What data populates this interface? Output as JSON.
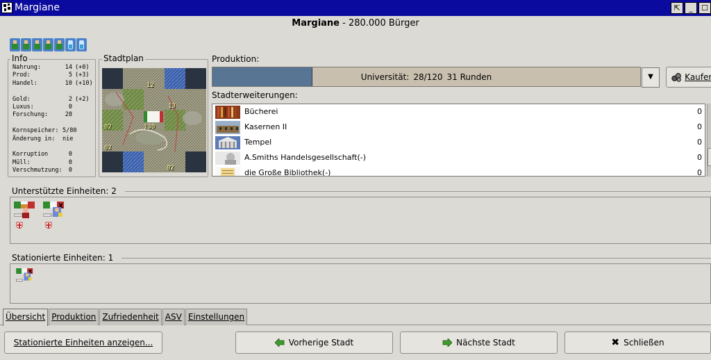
{
  "window": {
    "title": "Margiane",
    "controls": {
      "pin": "⇱",
      "minimize": "_",
      "maximize": "☐"
    }
  },
  "header": {
    "city_name": "Margiane",
    "population": "- 280.000 Bürger"
  },
  "citizens": {
    "icons": [
      "worker-citizen-icon",
      "worker-citizen-icon",
      "worker-citizen-icon",
      "worker-citizen-icon",
      "worker-citizen-icon",
      "scientist-citizen-icon",
      "scientist-citizen-icon"
    ]
  },
  "info": {
    "label": "Info",
    "rows": [
      {
        "key": "Nahrung:",
        "value": "14",
        "delta": "(+0)"
      },
      {
        "key": "Prod:",
        "value": "5",
        "delta": "(+3)"
      },
      {
        "key": "Handel:",
        "value": "10",
        "delta": "(+10)"
      },
      {
        "key": "Gold:",
        "value": "2",
        "delta": "(+2)"
      },
      {
        "key": "Luxus:",
        "value": "0",
        "delta": ""
      },
      {
        "key": "Forschung:",
        "value": "28",
        "delta": ""
      },
      {
        "key": "Kornspeicher:",
        "value": "5/80",
        "delta": ""
      },
      {
        "key": "Änderung in:",
        "value": "nie",
        "delta": ""
      },
      {
        "key": "Korruption",
        "value": "0",
        "delta": ""
      },
      {
        "key": "Müll:",
        "value": "0",
        "delta": ""
      },
      {
        "key": "Verschmutzung:",
        "value": "0",
        "delta": ""
      }
    ]
  },
  "city_map": {
    "label": "Stadtplan",
    "numbers": [
      "12",
      "13",
      "02",
      "130",
      "02",
      "02",
      "02"
    ]
  },
  "production": {
    "label": "Produktion:",
    "item": "Universität:",
    "progress_text": "28/120",
    "turns": "31 Runden",
    "progress_fraction": 0.233,
    "buy_label": "Kaufen"
  },
  "extensions": {
    "label": "Stadterweiterungen:",
    "items": [
      {
        "name": "Bücherei",
        "value": "0"
      },
      {
        "name": "Kasernen II",
        "value": "0"
      },
      {
        "name": "Tempel",
        "value": "0"
      },
      {
        "name": "A.Smiths Handelsgesellschaft(-)",
        "value": "0"
      },
      {
        "name": "die Große Bibliothek(-)",
        "value": "0"
      }
    ]
  },
  "supported_units": {
    "label": "Unterstützte Einheiten: 2"
  },
  "stationed_units": {
    "label": "Stationierte Einheiten: 1"
  },
  "tabs": [
    "Übersicht",
    "Produktion",
    "Zufriedenheit",
    "ASV",
    "Einstellungen"
  ],
  "buttons": {
    "show_units": "Stationierte Einheiten anzeigen...",
    "prev_city": "Vorherige Stadt",
    "next_city": "Nächste Stadt",
    "close": "Schließen"
  },
  "colors": {
    "titlebar": "#0a0a9e",
    "progress_fill": "#587594",
    "progress_bg": "#c8bfae",
    "arrow_green": "#3f9b2e"
  }
}
